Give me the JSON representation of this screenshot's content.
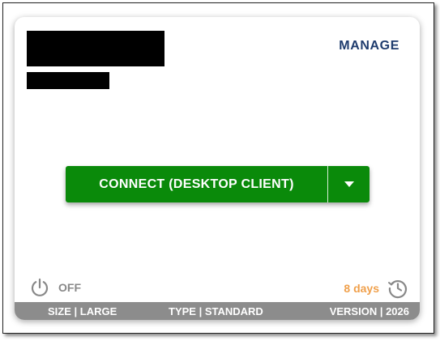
{
  "card": {
    "manage_label": "MANAGE",
    "connect_label": "CONNECT (DESKTOP CLIENT)",
    "power_state": "OFF",
    "days_label": "8 days",
    "footer": {
      "size": "SIZE | LARGE",
      "type": "TYPE | STANDARD",
      "version": "VERSION | 2026"
    }
  },
  "colors": {
    "accent_green": "#0a8a0a",
    "manage_blue": "#1f3c6e",
    "days_orange": "#f0a04b",
    "footer_gray": "#8c8c8c",
    "icon_gray": "#888888"
  },
  "icons": {
    "power": "power-icon",
    "dropdown": "caret-down-icon",
    "history": "clock-history-icon"
  }
}
